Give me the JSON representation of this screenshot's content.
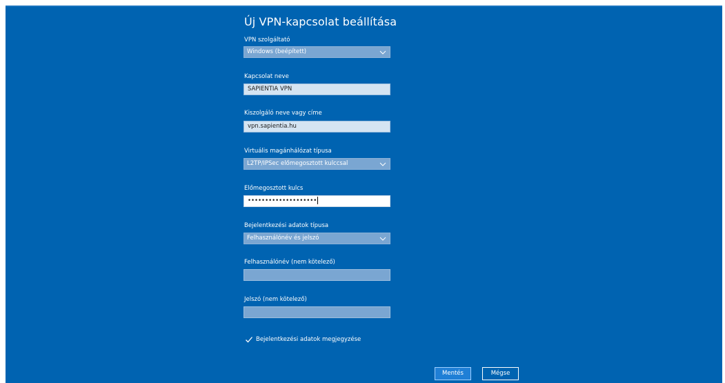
{
  "dialog": {
    "title": "Új VPN-kapcsolat beállítása",
    "fields": {
      "provider": {
        "label": "VPN szolgáltató",
        "value": "Windows (beépített)"
      },
      "connection_name": {
        "label": "Kapcsolat neve",
        "value": "SAPIENTIA VPN"
      },
      "server": {
        "label": "Kiszolgáló neve vagy címe",
        "value": "vpn.sapientia.hu"
      },
      "vpn_type": {
        "label": "Virtuális magánhálózat típusa",
        "value": "L2TP/IPSec előmegosztott kulccsal"
      },
      "preshared_key": {
        "label": "Előmegosztott kulcs",
        "value": "••••••••••••••••••••"
      },
      "signin_type": {
        "label": "Bejelentkezési adatok típusa",
        "value": "Felhasználónév és jelszó"
      },
      "username": {
        "label": "Felhasználónév (nem kötelező)",
        "value": ""
      },
      "password": {
        "label": "Jelszó (nem kötelező)",
        "value": ""
      }
    },
    "remember": {
      "label": "Bejelentkezési adatok megjegyzése",
      "checked": true
    },
    "buttons": {
      "save": "Mentés",
      "cancel": "Mégse"
    }
  },
  "icons": {
    "dropdown": "chevron-down-icon",
    "checkbox": "checkmark-icon"
  },
  "colors": {
    "background": "#0063b1",
    "accent": "#1f7fd6"
  }
}
